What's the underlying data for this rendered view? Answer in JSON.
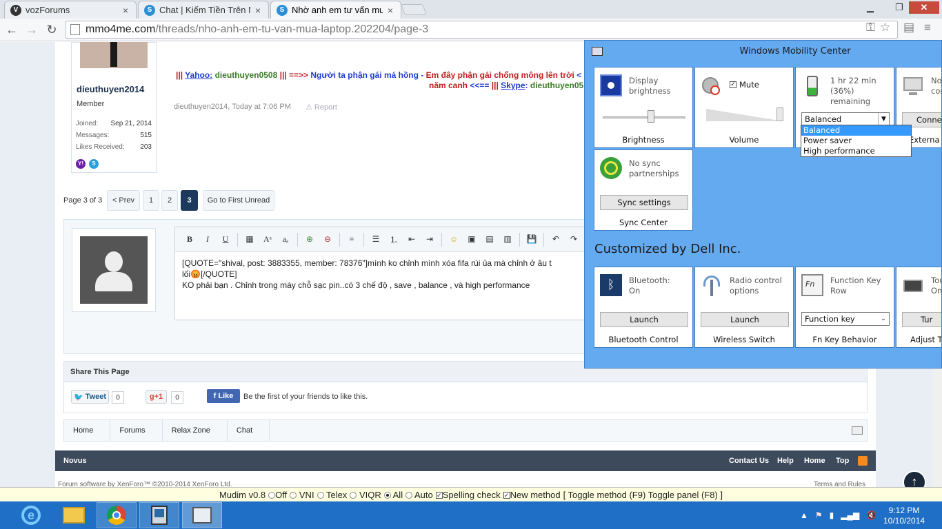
{
  "browser": {
    "tabs": [
      {
        "title": "vozForums",
        "favicon_letter": "V"
      },
      {
        "title": "Chat | Kiếm Tiền Trên Mạ",
        "favicon_letter": "S"
      },
      {
        "title": "Nhờ anh em tư vấn mua l",
        "favicon_letter": "S"
      }
    ],
    "url_host": "mmo4me.com",
    "url_path": "/threads/nho-anh-em-tu-van-mua-laptop.202204/page-3"
  },
  "post": {
    "username": "dieuthuyen2014",
    "user_title": "Member",
    "stats": [
      {
        "label": "Joined:",
        "value": "Sep 21, 2014"
      },
      {
        "label": "Messages:",
        "value": "515"
      },
      {
        "label": "Likes Received:",
        "value": "203"
      }
    ],
    "signature": {
      "part1_pipes": "|||",
      "part1_yahoo": "Yahoo:",
      "part1_yahoo_id": "dieuthuyen0508",
      "part1_arrow": "|||  ==>>",
      "part1_text": "Người ta phận gái má hồng -",
      "part1_red": "Em đây phận gái chổng mông lên trời",
      "part1_end": "<",
      "part2_red": "năm canh",
      "part2_arrow": "<<==",
      "part2_pipes": "|||",
      "part2_skype": "Skype",
      "part2_colon": ":",
      "part2_id": "dieuthuyen05"
    },
    "meta": "dieuthuyen2014, Today at 7:06 PM",
    "report": "Report"
  },
  "pagination": {
    "label": "Page 3 of 3",
    "prev": "< Prev",
    "pages": [
      "1",
      "2",
      "3"
    ],
    "current": "3",
    "first_unread": "Go to First Unread"
  },
  "editor": {
    "line1": "[QUOTE=\"shival, post: 3883355, member: 78376\"]mình ko chỉnh mình xóa fifa rùi ủa mà chỉnh ở âu t",
    "line2": "lối😡[/QUOTE]",
    "line3": "KO phải bạn . Chỉnh trong máy chỗ sạc pin..có 3 chế độ , save , balance , và high performance"
  },
  "share": {
    "title": "Share This Page",
    "tweet": "Tweet",
    "tweet_count": "0",
    "gplus": "+1",
    "gplus_count": "0",
    "fb_like": "Like",
    "fb_text": "Be the first of your friends to like this."
  },
  "breadcrumb": [
    "Home",
    "Forums",
    "Relax Zone",
    "Chat"
  ],
  "footer": {
    "brand": "Novus",
    "links": [
      "Contact Us",
      "Help",
      "Home",
      "Top"
    ],
    "copyright": "Forum software by XenForo™ ©2010-2014 XenForo Ltd.",
    "terms": "Terms and Rules"
  },
  "mobility_center": {
    "title": "Windows Mobility Center",
    "tiles": {
      "brightness": {
        "label": "Display\nbrightness",
        "footer": "Brightness"
      },
      "volume": {
        "mute": "Mute",
        "footer": "Volume"
      },
      "battery": {
        "status": "1 hr 22 min\n(36%) remaining",
        "selected": "Balanced",
        "footer": ""
      },
      "display": {
        "label": "No\ncon",
        "button": "Connec",
        "footer": "Externa"
      },
      "sync": {
        "label": "No sync\npartnerships",
        "button": "Sync settings",
        "footer": "Sync Center"
      }
    },
    "power_options": [
      "Balanced",
      "Power saver",
      "High performance"
    ],
    "customized_by": "Customized by Dell Inc.",
    "custom_tiles": [
      {
        "label": "Bluetooth:\nOn",
        "button": "Launch",
        "footer": "Bluetooth Control"
      },
      {
        "label": "Radio control\noptions",
        "button": "Launch",
        "footer": "Wireless Switch"
      },
      {
        "label": "Function Key\nRow",
        "select": "Function key",
        "footer": "Fn Key Behavior"
      },
      {
        "label": "Tou\nOn",
        "button": "Tur",
        "footer": "Adjust T"
      }
    ]
  },
  "mudim": {
    "name": "Mudim v0.8",
    "options": [
      "Off",
      "VNI",
      "Telex",
      "VIQR",
      "All",
      "Auto"
    ],
    "selected": "All",
    "spell": "Spelling check",
    "newmethod": "New method",
    "toggle": "[ Toggle method (F9) Toggle panel (F8) ]"
  },
  "taskbar": {
    "time": "9:12 PM",
    "date": "10/10/2014"
  },
  "colors": {
    "taskbar": "#1e6fc5",
    "wmc_bg": "#64aaf0",
    "footer": "#3d4a5c",
    "page_current": "#1d3a5e"
  }
}
